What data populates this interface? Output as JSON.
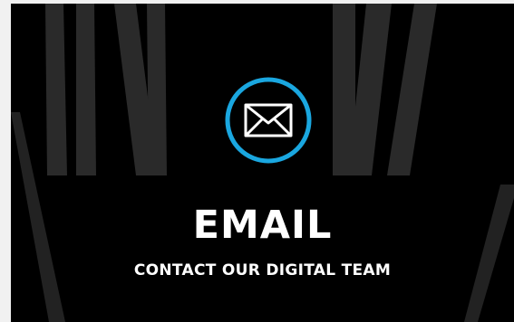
{
  "card": {
    "title": "EMAIL",
    "subtitle": "CONTACT OUR DIGITAL TEAM",
    "icon": "mail-envelope-icon"
  },
  "colors": {
    "background": "#000000",
    "page": "#f1f1f1",
    "accent_ring": "#1aa7e0",
    "text": "#ffffff",
    "stripes": "#2a2a2a"
  }
}
